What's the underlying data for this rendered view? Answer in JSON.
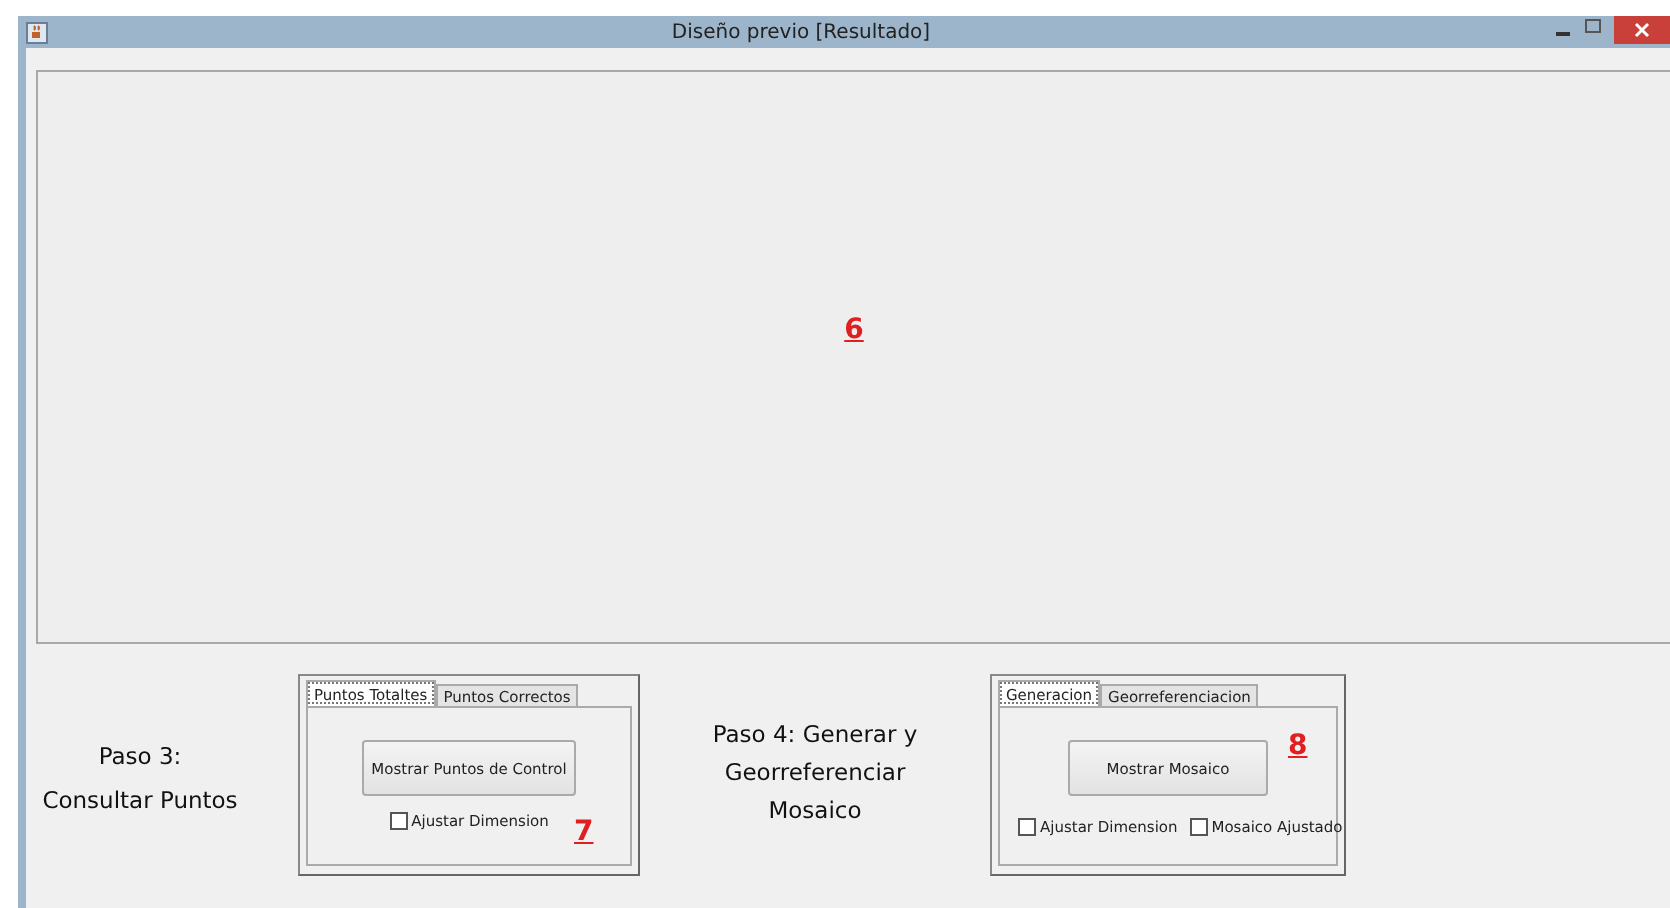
{
  "window": {
    "title": "Diseño previo [Resultado]"
  },
  "preview": {
    "label": "6"
  },
  "step_3": {
    "text": "Paso 3:\nConsultar Puntos"
  },
  "panel_7": {
    "tabs": [
      {
        "label": "Puntos Totaltes",
        "selected": true
      },
      {
        "label": "Puntos Correctos",
        "selected": false
      }
    ],
    "button": "Mostrar Puntos de Control",
    "checkboxes": [
      {
        "label": "Ajustar Dimension",
        "checked": false
      }
    ],
    "marker": "7"
  },
  "step_4": {
    "text": "Paso 4: Generar y\nGeorreferenciar\nMosaico"
  },
  "panel_8": {
    "tabs": [
      {
        "label": "Generacion",
        "selected": true
      },
      {
        "label": "Georreferenciacion",
        "selected": false
      }
    ],
    "button": "Mostrar Mosaico",
    "checkboxes": [
      {
        "label": "Ajustar Dimension",
        "checked": false
      },
      {
        "label": "Mosaico Ajustado",
        "checked": false
      }
    ],
    "marker": "8"
  }
}
